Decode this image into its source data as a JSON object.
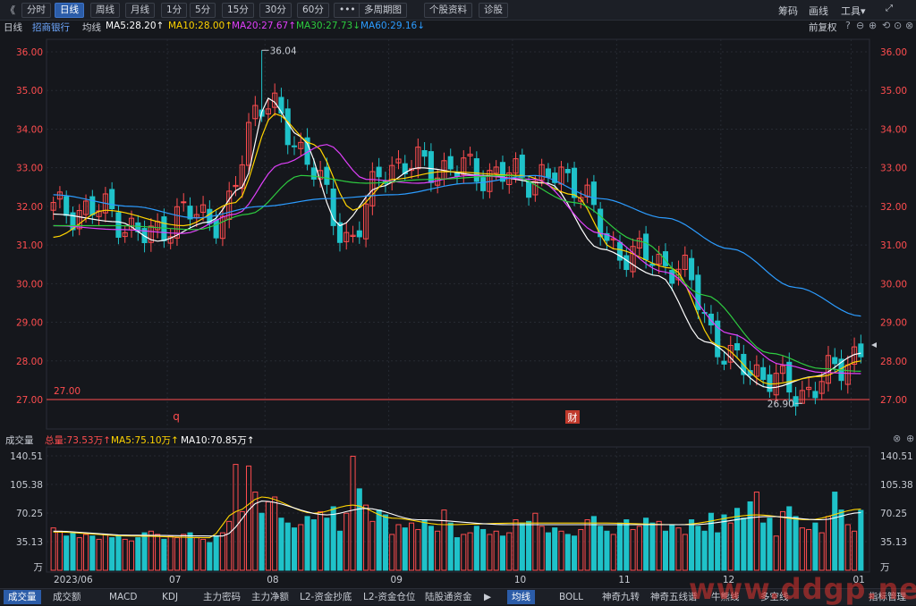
{
  "toolbar": {
    "back": "《",
    "tabs": [
      "分时",
      "日线",
      "周线",
      "月线",
      "1分",
      "5分",
      "15分",
      "30分",
      "60分",
      "•••",
      "多周期图",
      "个股资料",
      "诊股"
    ],
    "active_tab": 1,
    "right": [
      "筹码",
      "画线",
      "工具▾"
    ]
  },
  "legend": {
    "period": "日线",
    "stock": "招商银行",
    "type": "均线",
    "ma5": "MA5:28.20↑",
    "ma10": "MA10:28.00↑",
    "ma20": "MA20:27.67↑",
    "ma30": "MA30:27.73↓",
    "ma60": "MA60:29.16↓",
    "adjust": "前复权",
    "controls": [
      "?",
      "⊖",
      "⊕",
      "⟲",
      "⊙",
      "⊗"
    ]
  },
  "volume_legend": {
    "title": "成交量",
    "total": "总量:73.53万↑",
    "ma5": "MA5:75.10万↑",
    "ma10": "MA10:70.85万↑"
  },
  "colors": {
    "up": "#ff4d4f",
    "down": "#1fc2c9",
    "ma5": "#ffffff",
    "ma10": "#ffd400",
    "ma20": "#e040fb",
    "ma30": "#2ecc40",
    "ma60": "#2c9cff"
  },
  "chart_data": [
    {
      "type": "candlestick",
      "title": "招商银行 日线",
      "ylim": [
        27.0,
        36.0
      ],
      "y_ticks": [
        "36.00",
        "35.00",
        "34.00",
        "33.00",
        "32.00",
        "31.00",
        "30.00",
        "29.00",
        "28.00",
        "27.00"
      ],
      "x_month_labels": [
        "2023/06",
        "07",
        "08",
        "09",
        "10",
        "11",
        "12",
        "01"
      ],
      "annotations": {
        "high": "36.04",
        "low": "26.90",
        "hline": "27.00",
        "marker_q": "q",
        "marker_cai": "财"
      },
      "anchors": [
        [
          0,
          31.9
        ],
        [
          8,
          31.9
        ],
        [
          14,
          31.2
        ],
        [
          20,
          31.8
        ],
        [
          26,
          31.7
        ],
        [
          32,
          34.8
        ],
        [
          38,
          33.5
        ],
        [
          45,
          31.2
        ],
        [
          52,
          33.1
        ],
        [
          60,
          33.0
        ],
        [
          70,
          32.8
        ],
        [
          80,
          32.7
        ],
        [
          86,
          30.9
        ],
        [
          95,
          30.5
        ],
        [
          105,
          27.9
        ],
        [
          115,
          27.2
        ],
        [
          124,
          28.2
        ]
      ],
      "series": [
        {
          "name": "MA5",
          "anchors": [
            [
              0,
              31.8
            ],
            [
              10,
              31.6
            ],
            [
              16,
              31.1
            ],
            [
              24,
              31.6
            ],
            [
              29,
              32.5
            ],
            [
              33,
              34.8
            ],
            [
              38,
              33.8
            ],
            [
              44,
              31.5
            ],
            [
              50,
              32.5
            ],
            [
              56,
              33.0
            ],
            [
              66,
              32.8
            ],
            [
              76,
              32.6
            ],
            [
              84,
              30.9
            ],
            [
              93,
              30.2
            ],
            [
              100,
              28.5
            ],
            [
              110,
              27.3
            ],
            [
              117,
              27.6
            ],
            [
              124,
              28.2
            ]
          ]
        },
        {
          "name": "MA10",
          "anchors": [
            [
              0,
              31.2
            ],
            [
              8,
              31.9
            ],
            [
              20,
              31.5
            ],
            [
              28,
              32.1
            ],
            [
              34,
              34.4
            ],
            [
              40,
              33.6
            ],
            [
              46,
              31.9
            ],
            [
              52,
              32.7
            ],
            [
              60,
              32.9
            ],
            [
              72,
              32.8
            ],
            [
              80,
              32.3
            ],
            [
              86,
              30.9
            ],
            [
              95,
              30.4
            ],
            [
              102,
              28.4
            ],
            [
              110,
              27.4
            ],
            [
              118,
              27.6
            ],
            [
              124,
              28.0
            ]
          ]
        },
        {
          "name": "MA20",
          "anchors": [
            [
              0,
              31.5
            ],
            [
              10,
              31.4
            ],
            [
              20,
              31.3
            ],
            [
              28,
              31.8
            ],
            [
              35,
              33.1
            ],
            [
              42,
              33.6
            ],
            [
              48,
              32.7
            ],
            [
              56,
              32.6
            ],
            [
              64,
              32.8
            ],
            [
              74,
              32.7
            ],
            [
              84,
              31.3
            ],
            [
              94,
              30.3
            ],
            [
              104,
              28.7
            ],
            [
              112,
              27.9
            ],
            [
              118,
              27.7
            ],
            [
              124,
              27.67
            ]
          ]
        },
        {
          "name": "MA30",
          "anchors": [
            [
              0,
              31.5
            ],
            [
              10,
              31.5
            ],
            [
              22,
              31.4
            ],
            [
              30,
              31.8
            ],
            [
              38,
              32.8
            ],
            [
              48,
              32.6
            ],
            [
              58,
              32.7
            ],
            [
              70,
              32.8
            ],
            [
              80,
              32.1
            ],
            [
              90,
              31.1
            ],
            [
              100,
              29.7
            ],
            [
              110,
              28.2
            ],
            [
              118,
              27.8
            ],
            [
              124,
              27.73
            ]
          ]
        },
        {
          "name": "MA60",
          "anchors": [
            [
              0,
              32.3
            ],
            [
              12,
              32.0
            ],
            [
              22,
              31.7
            ],
            [
              32,
              32.0
            ],
            [
              42,
              32.2
            ],
            [
              52,
              32.3
            ],
            [
              64,
              32.6
            ],
            [
              74,
              32.8
            ],
            [
              84,
              32.2
            ],
            [
              94,
              31.7
            ],
            [
              104,
              30.9
            ],
            [
              114,
              29.9
            ],
            [
              124,
              29.16
            ]
          ]
        }
      ]
    },
    {
      "type": "bar",
      "title": "成交量",
      "unit": "万",
      "ylim": [
        0,
        140.51
      ],
      "y_ticks": [
        "140.51",
        "105.38",
        "70.25",
        "35.13",
        "万"
      ],
      "values": [
        52,
        48,
        42,
        46,
        40,
        44,
        42,
        38,
        44,
        40,
        42,
        38,
        36,
        40,
        46,
        48,
        44,
        38,
        42,
        40,
        44,
        46,
        40,
        38,
        34,
        42,
        46,
        60,
        130,
        72,
        128,
        96,
        70,
        84,
        90,
        64,
        58,
        52,
        56,
        66,
        62,
        72,
        64,
        78,
        48,
        70,
        140,
        100,
        80,
        60,
        74,
        68,
        44,
        56,
        52,
        58,
        50,
        62,
        54,
        48,
        74,
        58,
        40,
        44,
        46,
        54,
        50,
        44,
        48,
        42,
        46,
        62,
        58,
        60,
        70,
        54,
        46,
        52,
        48,
        44,
        42,
        50,
        62,
        66,
        54,
        48,
        44,
        58,
        62,
        50,
        54,
        64,
        58,
        60,
        48,
        56,
        52,
        44,
        62,
        54,
        48,
        70,
        46,
        68,
        58,
        76,
        64,
        84,
        96,
        58,
        64,
        42,
        72,
        78,
        66,
        52,
        50,
        58,
        46,
        66,
        96,
        74,
        56,
        48,
        73.53
      ],
      "series": [
        {
          "name": "MA5",
          "anchors": [
            [
              0,
              47
            ],
            [
              12,
              42
            ],
            [
              24,
              40
            ],
            [
              28,
              72
            ],
            [
              32,
              90
            ],
            [
              40,
              70
            ],
            [
              46,
              80
            ],
            [
              52,
              64
            ],
            [
              60,
              56
            ],
            [
              72,
              58
            ],
            [
              84,
              58
            ],
            [
              96,
              56
            ],
            [
              108,
              68
            ],
            [
              116,
              62
            ],
            [
              124,
              75.1
            ]
          ]
        },
        {
          "name": "MA10",
          "anchors": [
            [
              0,
              48
            ],
            [
              12,
              43
            ],
            [
              26,
              42
            ],
            [
              32,
              85
            ],
            [
              42,
              68
            ],
            [
              48,
              76
            ],
            [
              56,
              62
            ],
            [
              70,
              56
            ],
            [
              84,
              56
            ],
            [
              98,
              56
            ],
            [
              110,
              66
            ],
            [
              118,
              62
            ],
            [
              124,
              70.85
            ]
          ]
        }
      ]
    }
  ]
}
